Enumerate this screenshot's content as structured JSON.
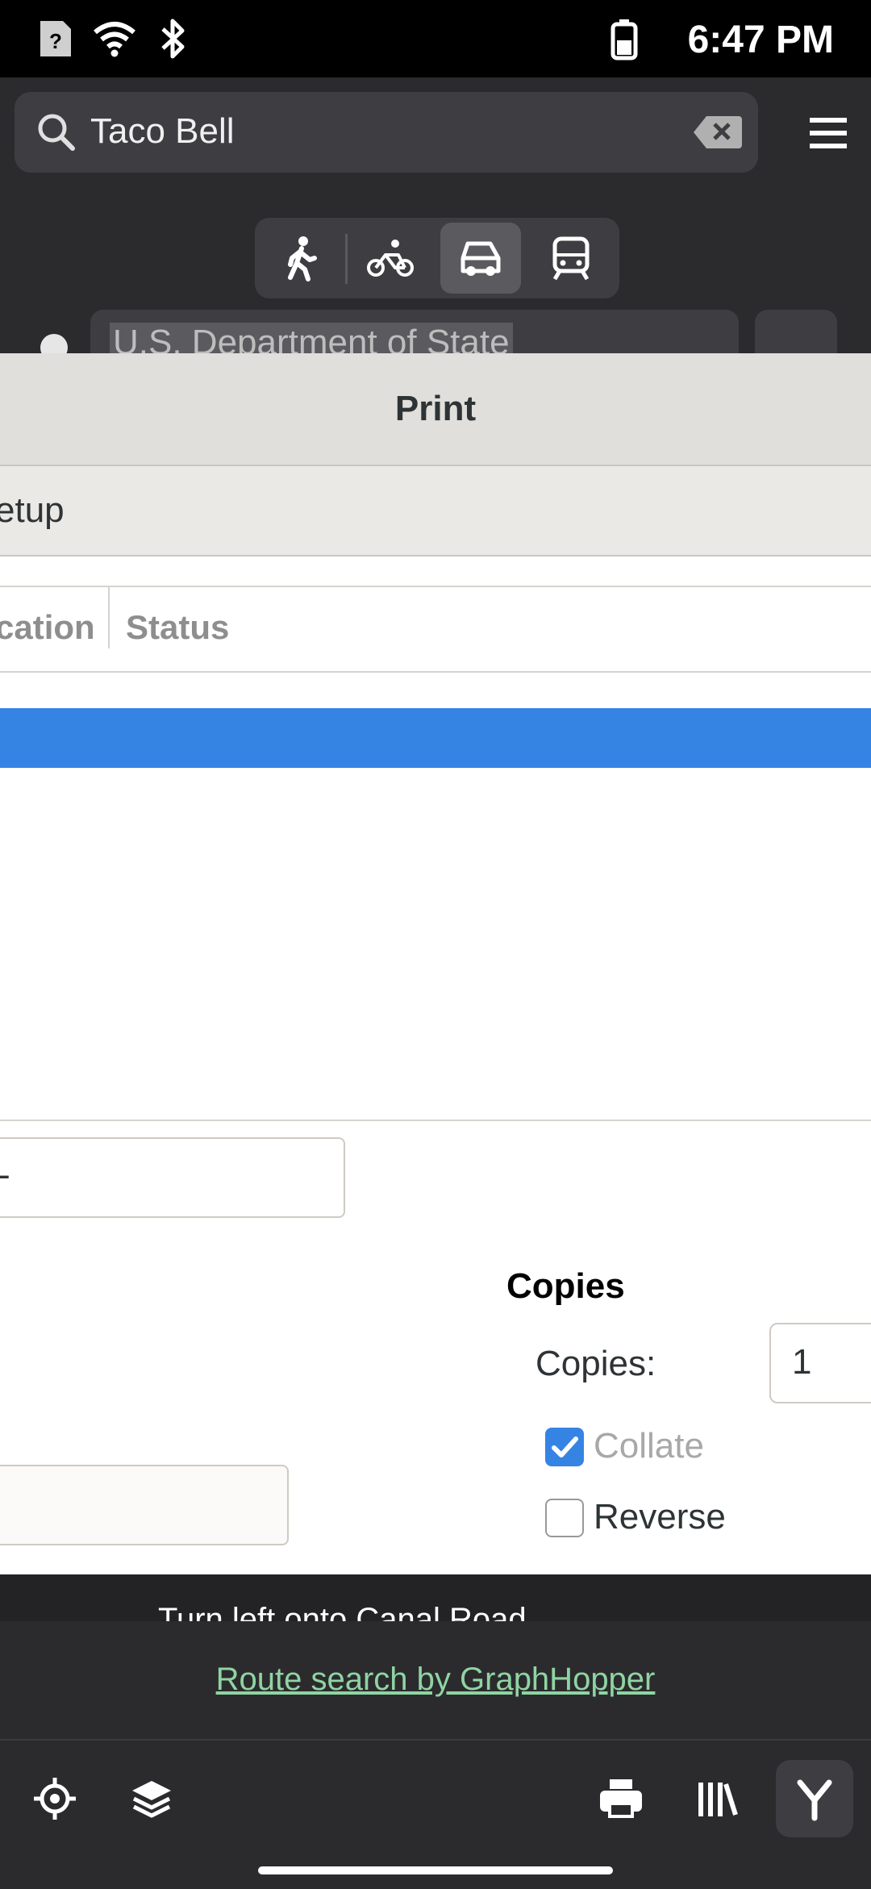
{
  "status_bar": {
    "time": "6:47 PM"
  },
  "search": {
    "value": "Taco Bell"
  },
  "route": {
    "modes": [
      "walk",
      "bike",
      "car",
      "transit"
    ],
    "active_mode": "car",
    "destination": "U.S. Department of State"
  },
  "print_dialog": {
    "title": "Print",
    "tab_label": "etup",
    "columns": {
      "location": "cation",
      "status": "Status"
    },
    "range_field_value": "-",
    "copies": {
      "heading": "Copies",
      "label": "Copies:",
      "value": "1",
      "collate_label": "Collate",
      "collate_checked": true,
      "reverse_label": "Reverse",
      "reverse_checked": false
    }
  },
  "directions": {
    "step_text": "Turn left onto Canal Road"
  },
  "footer": {
    "credit": "Route search by GraphHopper"
  },
  "colors": {
    "accent": "#3584e4",
    "link": "#8fd4a2",
    "app_bg": "#2b2b2e"
  },
  "toolbar": {
    "icons": [
      "locate-icon",
      "layers-icon",
      "print-icon",
      "library-icon",
      "route-icon"
    ]
  }
}
